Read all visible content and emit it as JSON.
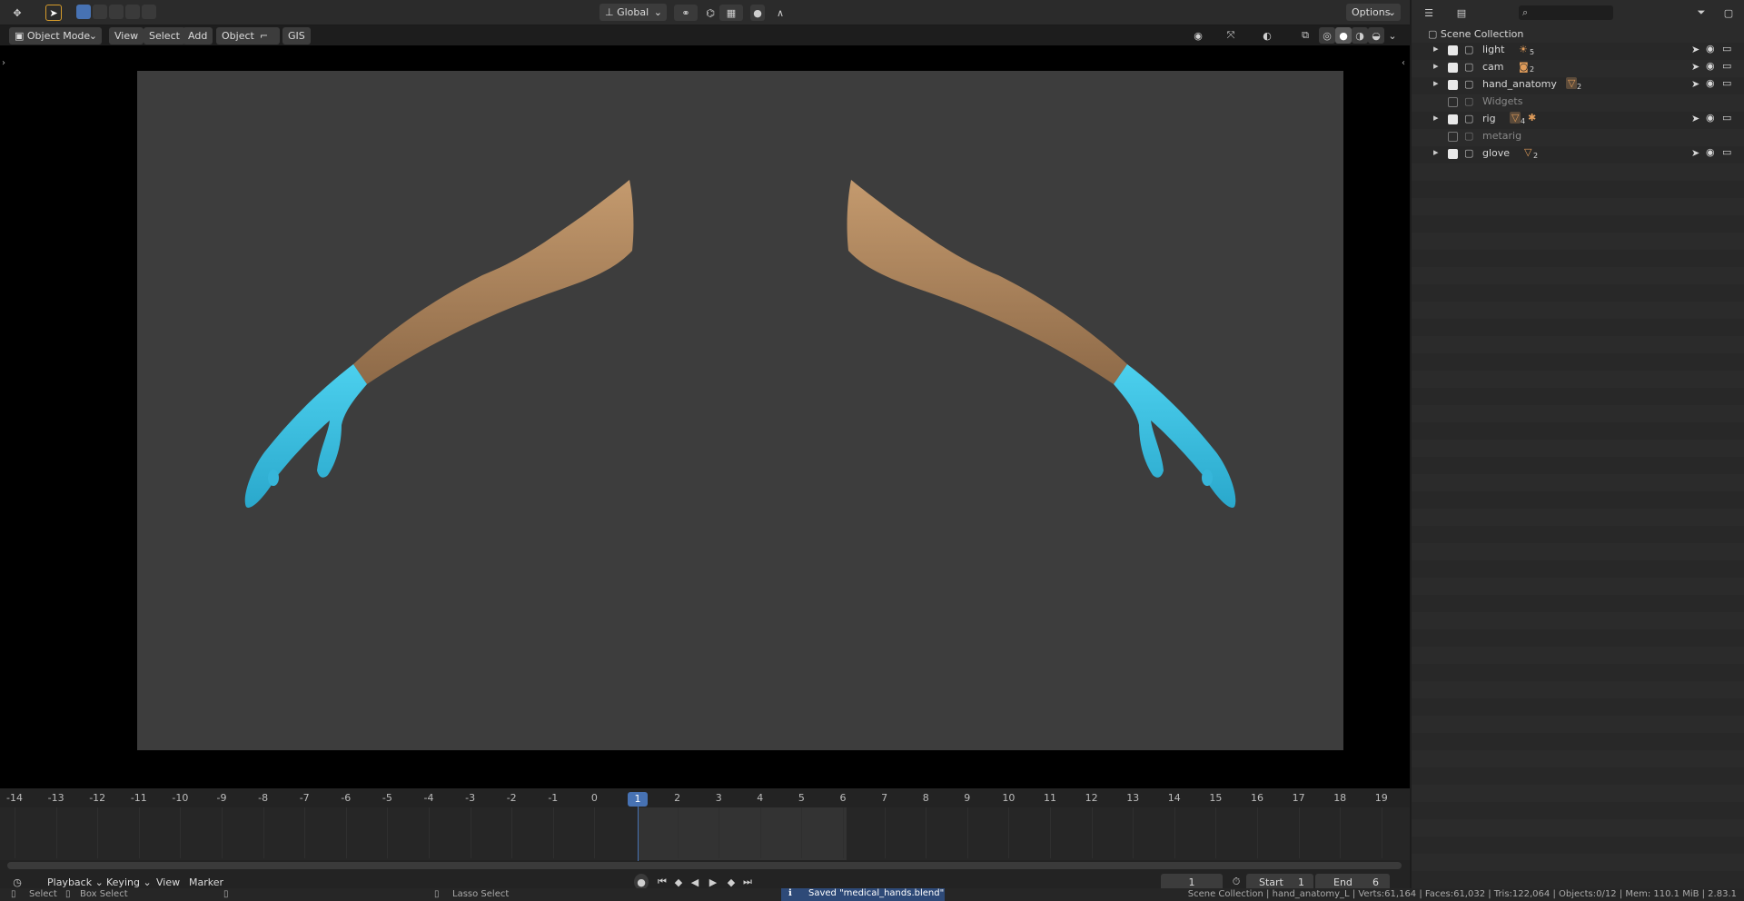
{
  "toolbar": {
    "transform_orientation": "Global",
    "options_label": "Options"
  },
  "viewport_header": {
    "mode": "Object Mode",
    "menus": [
      "View",
      "Select",
      "Add",
      "Object"
    ],
    "gis": "GIS"
  },
  "outliner": {
    "root": "Scene Collection",
    "items": [
      {
        "name": "light",
        "checked": true,
        "badge": "5"
      },
      {
        "name": "cam",
        "checked": true,
        "badge": "2"
      },
      {
        "name": "hand_anatomy",
        "checked": true,
        "badge": "2"
      },
      {
        "name": "Widgets",
        "checked": false,
        "badge": ""
      },
      {
        "name": "rig",
        "checked": true,
        "badge": "4"
      },
      {
        "name": "metarig",
        "checked": false,
        "badge": ""
      },
      {
        "name": "glove",
        "checked": true,
        "badge": "2"
      }
    ]
  },
  "timeline": {
    "ticks": [
      "-14",
      "-13",
      "-12",
      "-11",
      "-10",
      "-9",
      "-8",
      "-7",
      "-6",
      "-5",
      "-4",
      "-3",
      "-2",
      "-1",
      "0",
      "1",
      "2",
      "3",
      "4",
      "5",
      "6",
      "7",
      "8",
      "9",
      "10",
      "11",
      "12",
      "13",
      "14",
      "15",
      "16",
      "17",
      "18",
      "19"
    ],
    "current_frame": "1",
    "menus": [
      "Playback",
      "Keying",
      "View",
      "Marker"
    ],
    "frame_field": "1",
    "start_label": "Start",
    "start_value": "1",
    "end_label": "End",
    "end_value": "6"
  },
  "status": {
    "select": "Select",
    "box_select": "Box Select",
    "lasso_select": "Lasso Select",
    "message": "Saved \"medical_hands.blend\"",
    "info": "Scene Collection | hand_anatomy_L | Verts:61,164 | Faces:61,032 | Tris:122,064 | Objects:0/12 | Mem: 110.1 MiB | 2.83.1"
  },
  "colors": {
    "accent": "#4772b3",
    "skin": "#b48c64",
    "glove": "#3fc0e0"
  }
}
